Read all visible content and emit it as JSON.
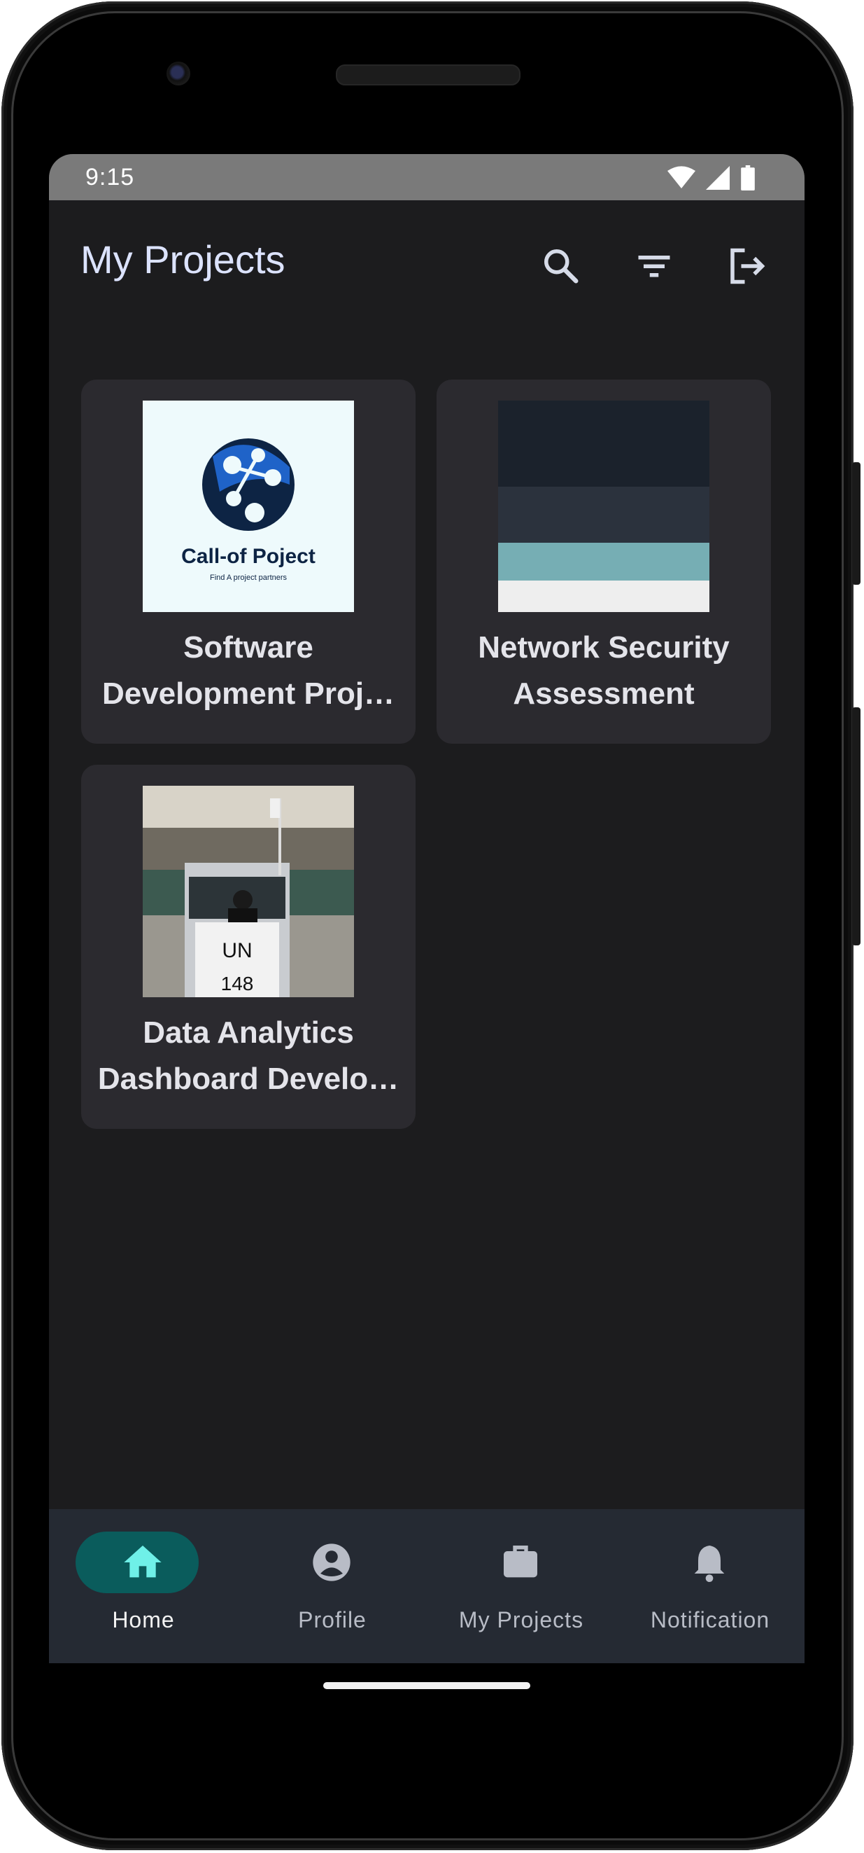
{
  "status_bar": {
    "time": "9:15",
    "icons": [
      "wifi-icon",
      "signal-icon",
      "battery-icon"
    ]
  },
  "app_bar": {
    "title": "My Projects",
    "actions": [
      "search-icon",
      "filter-icon",
      "logout-icon"
    ]
  },
  "projects": [
    {
      "title_line1": "Software",
      "title_line2": "Development Proj…",
      "logo_text": "Call-of Poject",
      "logo_tagline": "Find A project partners"
    },
    {
      "title_line1": "Network Security",
      "title_line2": "Assessment"
    },
    {
      "title_line1": "Data Analytics",
      "title_line2": "Dashboard Develo…",
      "photo_sign": "UN",
      "photo_sign_num": "148"
    }
  ],
  "bottom_nav": {
    "items": [
      {
        "label": "Home",
        "icon": "home-icon",
        "active": true
      },
      {
        "label": "Profile",
        "icon": "account-circle-icon",
        "active": false
      },
      {
        "label": "My Projects",
        "icon": "briefcase-icon",
        "active": false
      },
      {
        "label": "Notification",
        "icon": "bell-icon",
        "active": false
      }
    ]
  },
  "colors": {
    "background": "#1c1c1e",
    "card": "#2b2a2f",
    "title": "#dce3ff",
    "nav_active_pill": "#0a5c5c",
    "nav_active_icon": "#6ff0e8",
    "navbar": "#252a33"
  }
}
